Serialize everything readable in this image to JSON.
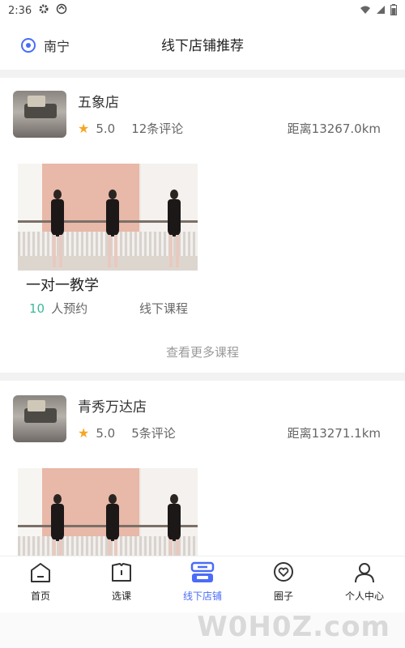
{
  "status": {
    "time": "2:36"
  },
  "header": {
    "location": "南宁",
    "title": "线下店铺推荐"
  },
  "stores": [
    {
      "name": "五象店",
      "rating": "5.0",
      "reviews": "12条评论",
      "distance": "距离13267.0km",
      "course": {
        "title": "一对一教学",
        "booked_count": "10",
        "booked_suffix": "人预约",
        "type": "线下课程"
      },
      "more": "查看更多课程"
    },
    {
      "name": "青秀万达店",
      "rating": "5.0",
      "reviews": "5条评论",
      "distance": "距离13271.1km"
    }
  ],
  "tabs": [
    {
      "label": "首页",
      "icon": "home-icon"
    },
    {
      "label": "选课",
      "icon": "book-icon"
    },
    {
      "label": "线下店铺",
      "icon": "store-icon"
    },
    {
      "label": "圈子",
      "icon": "heart-chat-icon"
    },
    {
      "label": "个人中心",
      "icon": "person-icon"
    }
  ],
  "watermark": "W0H0Z.com",
  "colors": {
    "accent": "#4a6cf7",
    "star": "#f5a623",
    "booked": "#3cb99a"
  }
}
